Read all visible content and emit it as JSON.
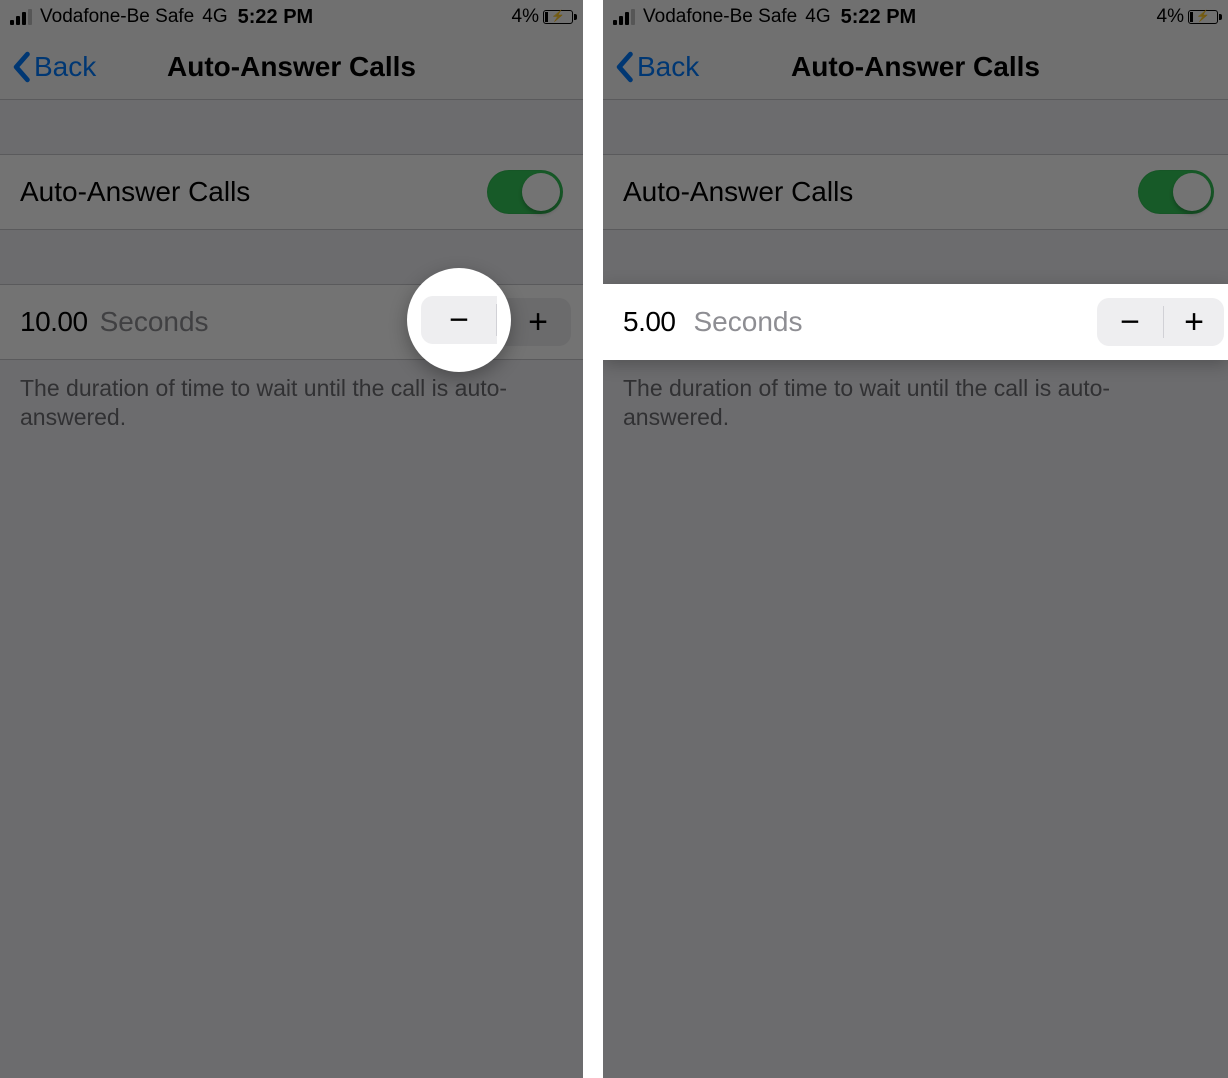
{
  "status_bar": {
    "carrier": "Vodafone-Be Safe",
    "network": "4G",
    "time": "5:22 PM",
    "battery_pct": "4%"
  },
  "nav": {
    "back_label": "Back",
    "title": "Auto-Answer Calls"
  },
  "toggle_row": {
    "label": "Auto-Answer Calls",
    "enabled": true
  },
  "stepper_row": {
    "unit": "Seconds",
    "minus": "−",
    "plus": "+"
  },
  "footer": "The duration of time to wait until the call is auto-answered.",
  "left": {
    "value": "10.00"
  },
  "right": {
    "value": "5.00"
  }
}
